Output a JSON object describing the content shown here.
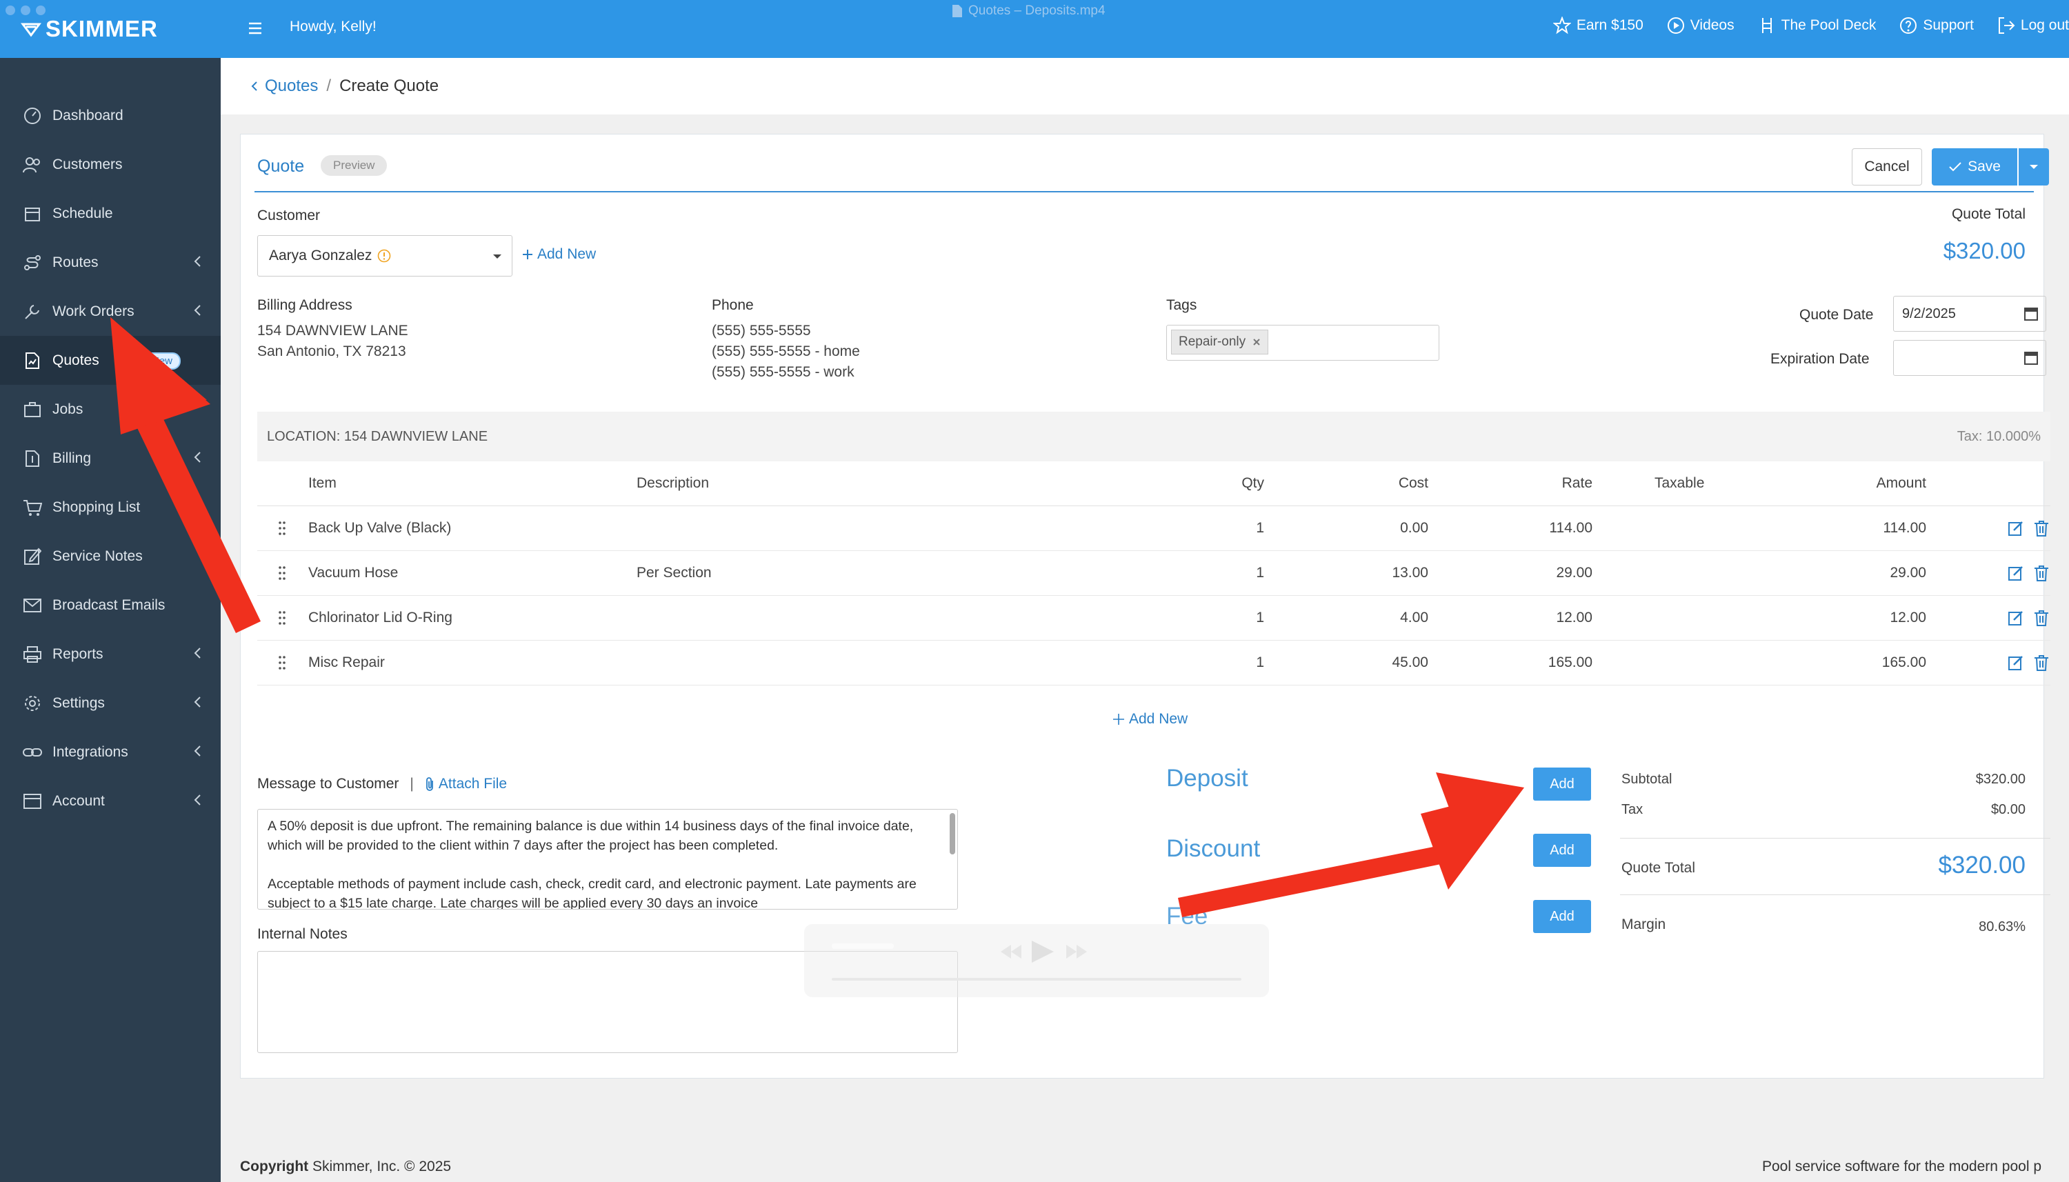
{
  "app": {
    "logo": "SKIMMER",
    "video_title": "Quotes – Deposits.mp4"
  },
  "topbar": {
    "greeting": "Howdy, Kelly!",
    "links": [
      "Earn $150",
      "Videos",
      "The Pool Deck",
      "Support",
      "Log out"
    ]
  },
  "sidebar": {
    "items": [
      {
        "label": "Dashboard",
        "icon": "dashboard-icon"
      },
      {
        "label": "Customers",
        "icon": "customers-icon"
      },
      {
        "label": "Schedule",
        "icon": "calendar-icon"
      },
      {
        "label": "Routes",
        "icon": "routes-icon"
      },
      {
        "label": "Work Orders",
        "icon": "wrench-icon"
      },
      {
        "label": "Quotes",
        "icon": "quote-icon",
        "badge": "New"
      },
      {
        "label": "Jobs",
        "icon": "briefcase-icon"
      },
      {
        "label": "Billing",
        "icon": "billing-icon"
      },
      {
        "label": "Shopping List",
        "icon": "cart-icon"
      },
      {
        "label": "Service Notes",
        "icon": "notes-icon"
      },
      {
        "label": "Broadcast Emails",
        "icon": "mail-icon"
      },
      {
        "label": "Reports",
        "icon": "printer-icon"
      },
      {
        "label": "Settings",
        "icon": "gear-icon"
      },
      {
        "label": "Integrations",
        "icon": "link-icon"
      },
      {
        "label": "Account",
        "icon": "account-icon"
      }
    ]
  },
  "breadcrumb": {
    "parent": "Quotes",
    "separator": "/",
    "current": "Create Quote"
  },
  "quote": {
    "title": "Quote",
    "preview": "Preview",
    "cancel": "Cancel",
    "save": "Save",
    "customer_label": "Customer",
    "customer_value": "Aarya Gonzalez",
    "add_new": "Add New",
    "quote_total_label": "Quote Total",
    "quote_total_value": "$320.00",
    "billing_label": "Billing Address",
    "billing_line1": "154 DAWNVIEW LANE",
    "billing_line2": "San Antonio, TX 78213",
    "phone_label": "Phone",
    "phone1": "(555) 555-5555",
    "phone2": "(555) 555-5555 - home",
    "phone3": "(555) 555-5555 - work",
    "tags_label": "Tags",
    "tag": "Repair-only",
    "quote_date_label": "Quote Date",
    "quote_date_value": "9/2/2025",
    "exp_date_label": "Expiration Date",
    "location": "LOCATION: 154 DAWNVIEW LANE",
    "tax_rate": "Tax: 10.000%"
  },
  "table": {
    "headers": {
      "item": "Item",
      "description": "Description",
      "qty": "Qty",
      "cost": "Cost",
      "rate": "Rate",
      "taxable": "Taxable",
      "amount": "Amount"
    },
    "rows": [
      {
        "item": "Back Up Valve (Black)",
        "description": "",
        "qty": "1",
        "cost": "0.00",
        "rate": "114.00",
        "amount": "114.00"
      },
      {
        "item": "Vacuum Hose",
        "description": "Per Section",
        "qty": "1",
        "cost": "13.00",
        "rate": "29.00",
        "amount": "29.00"
      },
      {
        "item": "Chlorinator Lid O-Ring",
        "description": "",
        "qty": "1",
        "cost": "4.00",
        "rate": "12.00",
        "amount": "12.00"
      },
      {
        "item": "Misc Repair",
        "description": "",
        "qty": "1",
        "cost": "45.00",
        "rate": "165.00",
        "amount": "165.00"
      }
    ],
    "add_new": "Add New"
  },
  "message": {
    "label": "Message to Customer",
    "divider": "|",
    "attach": "Attach File",
    "para1": "A 50% deposit is due upfront. The remaining balance is due within 14 business days of the final invoice date, which will be provided to the client within 7 days after the project has been completed.",
    "para2": "Acceptable methods of payment include cash, check, credit card, and electronic payment. Late payments are subject to a $15 late charge. Late charges will be applied every 30 days an invoice",
    "internal_label": "Internal Notes"
  },
  "adjustments": {
    "deposit": "Deposit",
    "discount": "Discount",
    "fee": "Fee",
    "add": "Add"
  },
  "summary": {
    "subtotal_label": "Subtotal",
    "subtotal_value": "$320.00",
    "tax_label": "Tax",
    "tax_value": "$0.00",
    "total_label": "Quote Total",
    "total_value": "$320.00",
    "margin_label": "Margin",
    "margin_value": "80.63%"
  },
  "footer": {
    "copyright_bold": "Copyright",
    "copyright": "Skimmer, Inc. © 2025",
    "tagline": "Pool service software for the modern pool p"
  },
  "colors": {
    "brand_blue": "#2e96e6",
    "sidebar": "#2c3e4f",
    "link": "#2a7fc6",
    "arrow_red": "#f0301e"
  }
}
